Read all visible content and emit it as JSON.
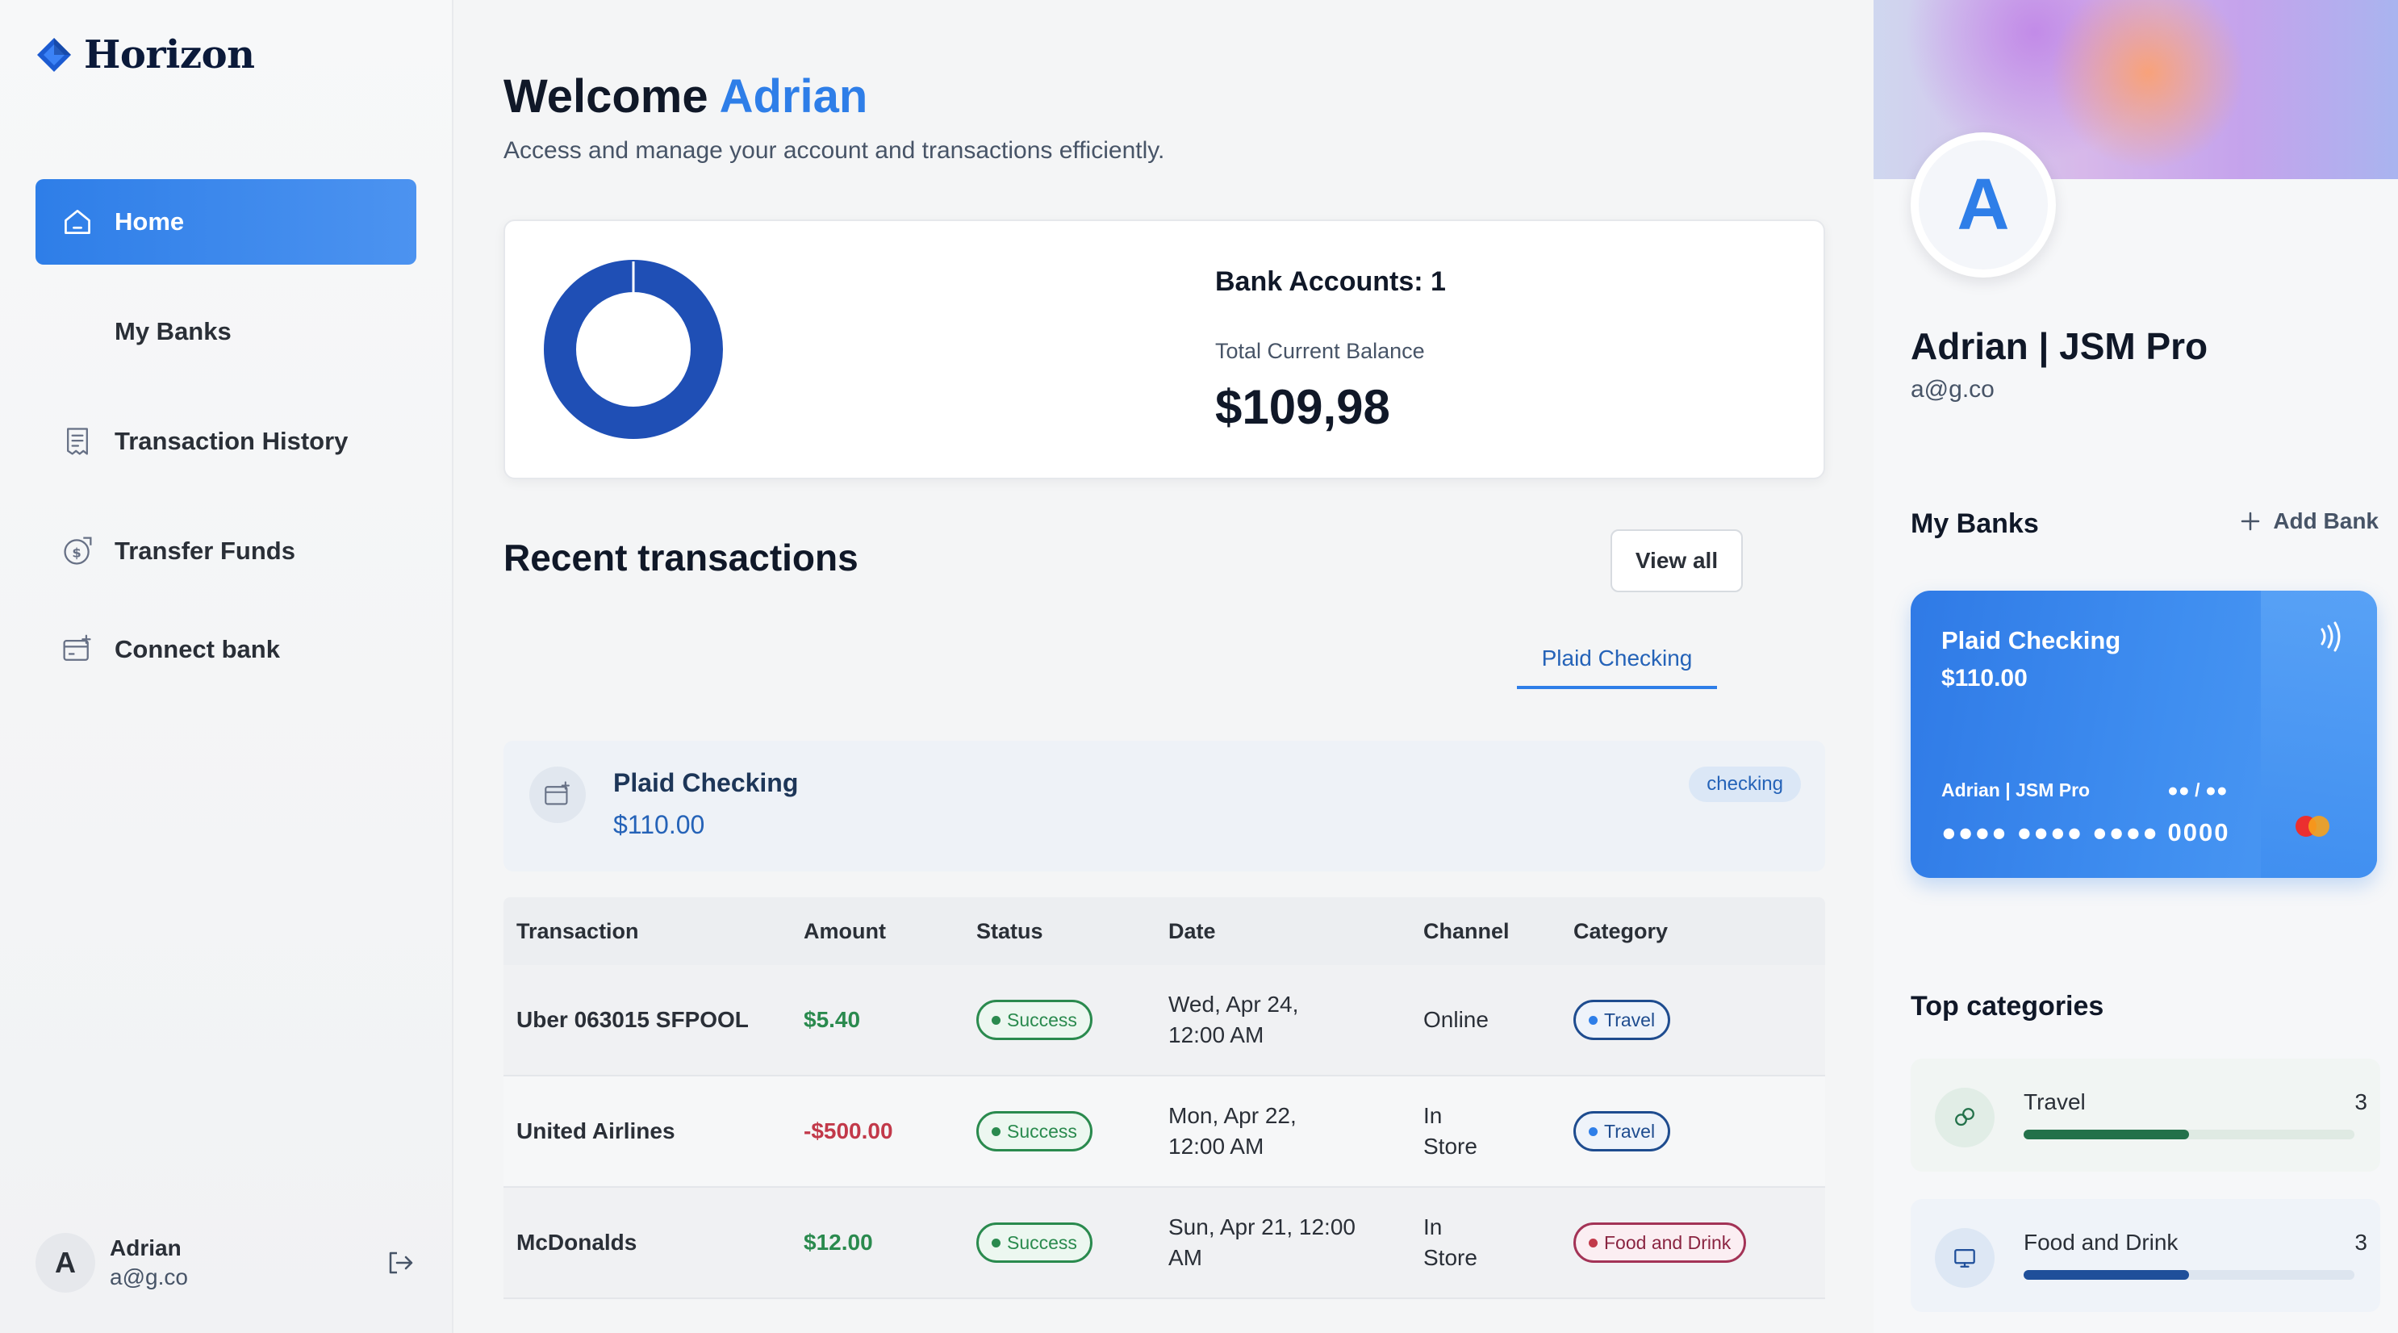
{
  "app": {
    "name": "Horizon"
  },
  "sidebar": {
    "items": [
      {
        "label": "Home",
        "icon": "home-icon",
        "active": true
      },
      {
        "label": "My Banks",
        "icon": "",
        "active": false
      },
      {
        "label": "Transaction History",
        "icon": "receipt-icon",
        "active": false
      },
      {
        "label": "Transfer Funds",
        "icon": "dollar-transfer-icon",
        "active": false
      },
      {
        "label": "Connect bank",
        "icon": "card-add-icon",
        "active": false
      }
    ],
    "user": {
      "initial": "A",
      "name": "Adrian",
      "email": "a@g.co"
    }
  },
  "header": {
    "welcome": "Welcome",
    "name": "Adrian",
    "subtitle": "Access and manage your account and transactions efficiently."
  },
  "balance": {
    "bank_accounts": "Bank Accounts: 1",
    "total_label": "Total Current Balance",
    "total_value": "$109,98",
    "donut_color": "#1f4fb5"
  },
  "recent": {
    "title": "Recent transactions",
    "view_all": "View all",
    "tab": "Plaid Checking",
    "account": {
      "name": "Plaid Checking",
      "amount": "$110.00",
      "type": "checking"
    },
    "columns": [
      "Transaction",
      "Amount",
      "Status",
      "Date",
      "Channel",
      "Category"
    ],
    "rows": [
      {
        "name": "Uber 063015 SFPOOL",
        "amount": "$5.40",
        "status": "Success",
        "date_line1": "Wed, Apr 24,",
        "date_line2": "12:00 AM",
        "channel_line1": "Online",
        "channel_line2": "",
        "category": "Travel"
      },
      {
        "name": "United Airlines",
        "amount": "-$500.00",
        "status": "Success",
        "date_line1": "Mon, Apr 22,",
        "date_line2": "12:00 AM",
        "channel_line1": "In",
        "channel_line2": "Store",
        "category": "Travel"
      },
      {
        "name": "McDonalds",
        "amount": "$12.00",
        "status": "Success",
        "date_line1": "Sun, Apr 21, 12:00",
        "date_line2": "AM",
        "channel_line1": "In",
        "channel_line2": "Store",
        "category": "Food and Drink"
      }
    ]
  },
  "profile": {
    "initial": "A",
    "name": "Adrian | JSM Pro",
    "email": "a@g.co"
  },
  "my_banks": {
    "title": "My Banks",
    "add_label": "Add Bank",
    "card": {
      "name": "Plaid Checking",
      "balance": "$110.00",
      "holder": "Adrian | JSM Pro",
      "expiry": "●● / ●●",
      "number": "●●●● ●●●● ●●●● 0000"
    }
  },
  "top_categories": {
    "title": "Top categories",
    "items": [
      {
        "name": "Travel",
        "count": "3",
        "fill_fraction": 0.5
      },
      {
        "name": "Food and Drink",
        "count": "3",
        "fill_fraction": 0.5
      }
    ]
  },
  "colors": {
    "accent": "#2e7ee8",
    "success": "#2a8a4e",
    "danger": "#c2394a"
  }
}
